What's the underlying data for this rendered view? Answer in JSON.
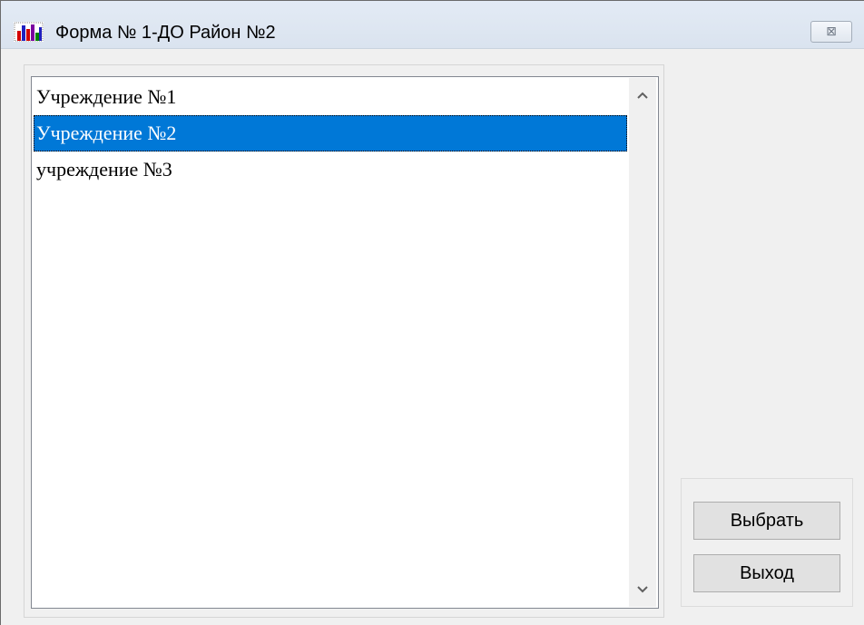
{
  "window": {
    "title": "Форма № 1-ДО Район №2",
    "close_glyph": "⊠"
  },
  "list": {
    "items": [
      {
        "label": "Учреждение №1",
        "selected": false
      },
      {
        "label": "Учреждение №2",
        "selected": true
      },
      {
        "label": "учреждение №3",
        "selected": false
      }
    ],
    "selection_color": "#0078d7"
  },
  "buttons": {
    "select_label": "Выбрать",
    "exit_label": "Выход"
  },
  "icons": {
    "app": "bar-chart-icon",
    "close": "close-icon",
    "scroll_up": "chevron-up-icon",
    "scroll_down": "chevron-down-icon"
  }
}
